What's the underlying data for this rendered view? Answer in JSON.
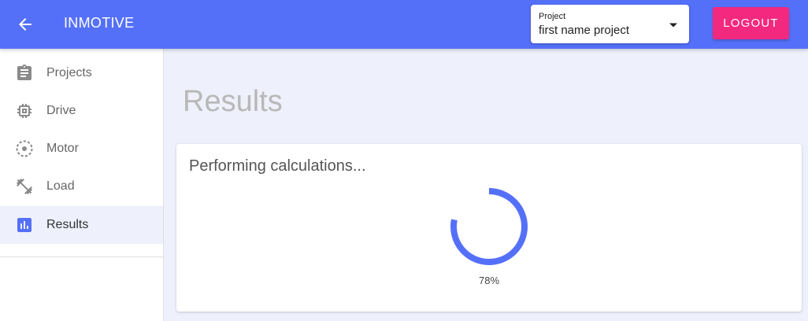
{
  "header": {
    "title": "INMOTIVE",
    "back_icon": "arrow-back-icon",
    "project_select": {
      "label": "Project",
      "value": "first name project",
      "icon": "caret-down-icon"
    },
    "logout_label": "LOGOUT"
  },
  "sidebar": {
    "items": [
      {
        "label": "Projects",
        "icon": "clipboard-icon",
        "active": false
      },
      {
        "label": "Drive",
        "icon": "chip-icon",
        "active": false
      },
      {
        "label": "Motor",
        "icon": "motor-icon",
        "active": false
      },
      {
        "label": "Load",
        "icon": "dumbbell-icon",
        "active": false
      },
      {
        "label": "Results",
        "icon": "bar-chart-icon",
        "active": true
      }
    ]
  },
  "main": {
    "title": "Results",
    "card": {
      "heading": "Performing calculations...",
      "progress_fraction": 0.78,
      "progress_text": "78%"
    }
  },
  "colors": {
    "primary": "#5570f8",
    "accent": "#f3287f",
    "icon_gray": "#8a8a8a"
  }
}
